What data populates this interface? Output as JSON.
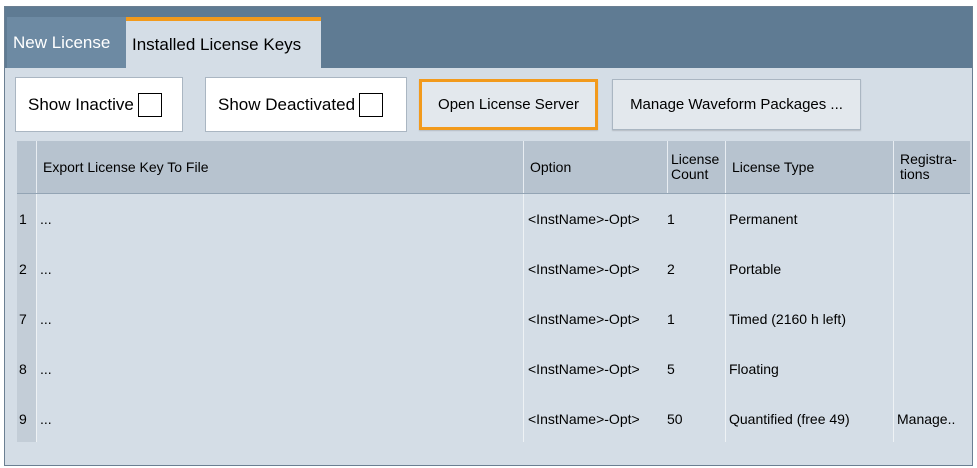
{
  "tabs": [
    {
      "label": "New License",
      "active": false
    },
    {
      "label": "Installed License Keys",
      "active": true
    }
  ],
  "toolbar": {
    "show_inactive_label": "Show Inactive",
    "show_inactive_checked": false,
    "show_deactivated_label": "Show Deactivated",
    "show_deactivated_checked": false,
    "open_license_server_label": "Open License Server",
    "manage_waveform_label": "Manage Waveform Packages ..."
  },
  "table": {
    "headers": {
      "export": "Export License Key To File",
      "option": "Option",
      "count_line1": "License",
      "count_line2": "Count",
      "type": "License Type",
      "reg_line1": "Registra-",
      "reg_line2": "tions"
    },
    "rows": [
      {
        "index": "1",
        "export": "...",
        "option": "<InstName>-Opt>",
        "count": "1",
        "type": "Permanent",
        "registrations": ""
      },
      {
        "index": "2",
        "export": "...",
        "option": "<InstName>-Opt>",
        "count": "2",
        "type": "Portable",
        "registrations": ""
      },
      {
        "index": "7",
        "export": "...",
        "option": "<InstName>-Opt>",
        "count": "1",
        "type": "Timed (2160 h left)",
        "registrations": ""
      },
      {
        "index": "8",
        "export": "...",
        "option": "<InstName>-Opt>",
        "count": "5",
        "type": "Floating",
        "registrations": ""
      },
      {
        "index": "9",
        "export": "...",
        "option": "<InstName>-Opt>",
        "count": "50",
        "type": "Quantified (free 49)",
        "registrations": "Manage.."
      }
    ]
  },
  "colors": {
    "accent": "#f29a1c",
    "tabbar": "#5f7b93",
    "panel": "#d4dde6"
  }
}
